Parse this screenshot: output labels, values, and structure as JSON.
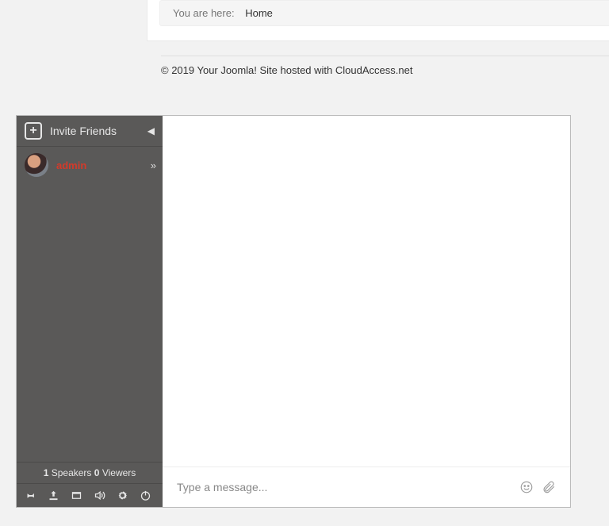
{
  "breadcrumb": {
    "prefix": "You are here:",
    "home": "Home"
  },
  "footer": "© 2019 Your Joomla! Site hosted with CloudAccess.net",
  "chat": {
    "invite_label": "Invite Friends",
    "user": {
      "name": "admin"
    },
    "stats": {
      "speakers_count": "1",
      "speakers_label": "Speakers",
      "viewers_count": "0",
      "viewers_label": "Viewers"
    },
    "input_placeholder": "Type a message..."
  }
}
